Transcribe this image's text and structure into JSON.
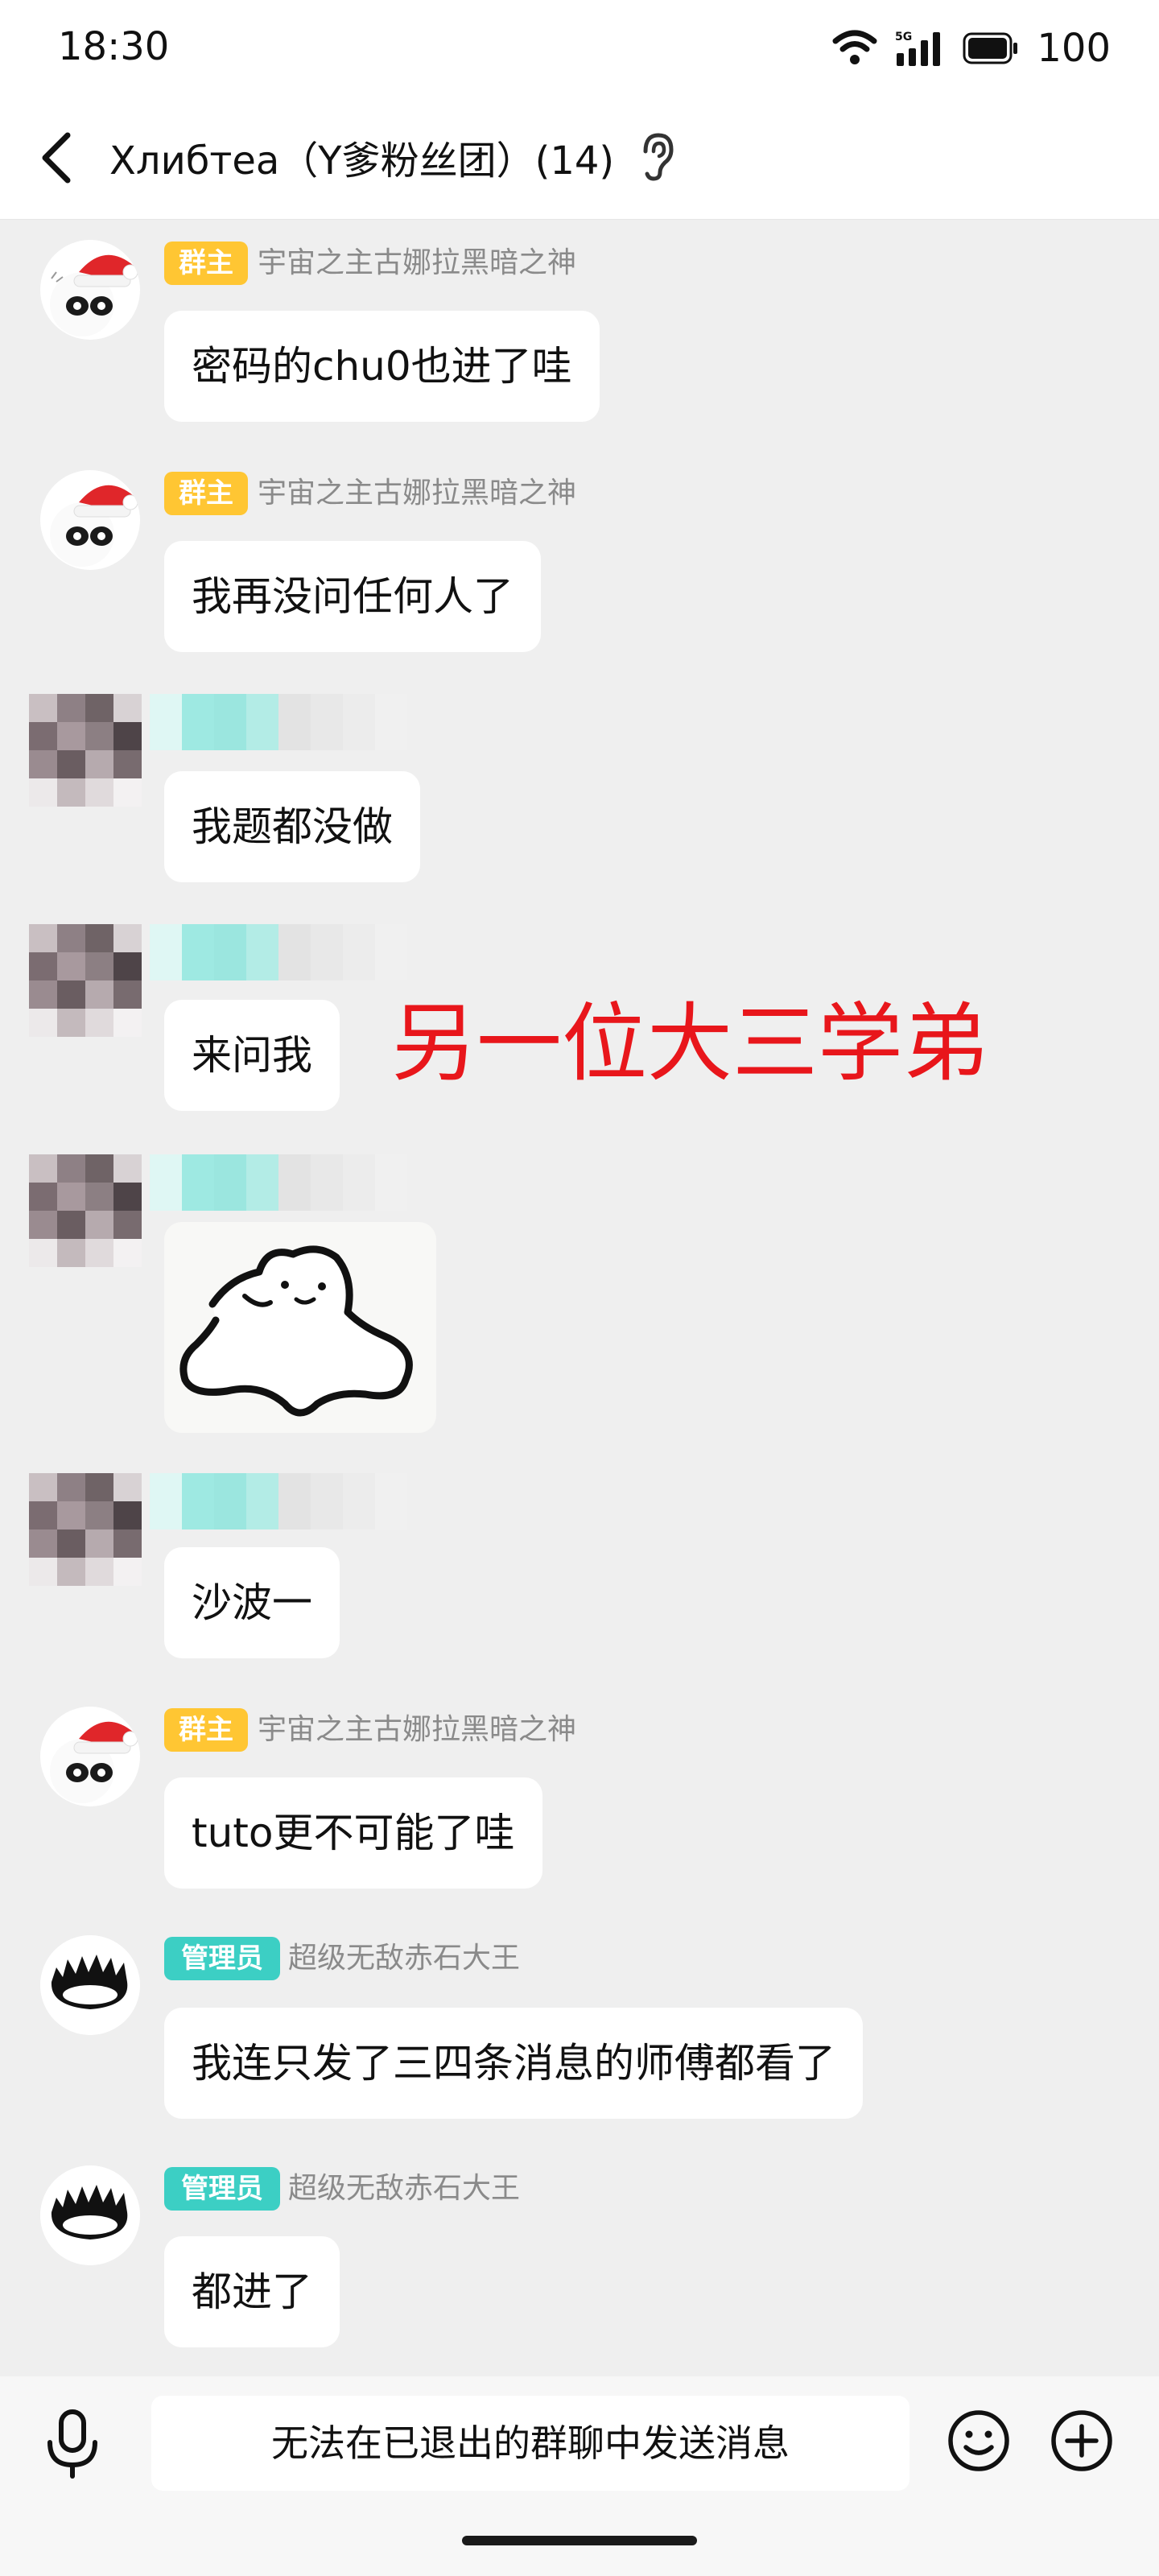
{
  "status_bar": {
    "time": "18:30",
    "network": "5G",
    "battery": "100"
  },
  "header": {
    "title": "Хлибтеа（Y爹粉丝团）(14)"
  },
  "messages": [
    {
      "badge": "群主",
      "sender": "宇宙之主古娜拉黑暗之神",
      "text": "密码的chu0也进了哇"
    },
    {
      "badge": "群主",
      "sender": "宇宙之主古娜拉黑暗之神",
      "text": "我再没问任何人了"
    },
    {
      "text": "我题都没做"
    },
    {
      "text": "来问我"
    },
    {
      "text": ""
    },
    {
      "text": "沙波一"
    },
    {
      "badge": "群主",
      "sender": "宇宙之主古娜拉黑暗之神",
      "text": "tuto更不可能了哇"
    },
    {
      "badge": "管理员",
      "sender": "超级无敌赤石大王",
      "text": "我连只发了三四条消息的师傅都看了"
    },
    {
      "badge": "管理员",
      "sender": "超级无敌赤石大王",
      "text": "都进了"
    }
  ],
  "annotation": "另一位大三学弟",
  "input": {
    "placeholder": "无法在已退出的群聊中发送消息"
  },
  "colors": {
    "owner_badge": "#ffc633",
    "admin_badge": "#3ccfc4",
    "annotation": "#e8161b",
    "background": "#efefef"
  },
  "icons": [
    "back-arrow-icon",
    "ear-icon",
    "wifi-icon",
    "signal-icon",
    "battery-icon",
    "microphone-icon",
    "emoji-icon",
    "plus-icon"
  ]
}
